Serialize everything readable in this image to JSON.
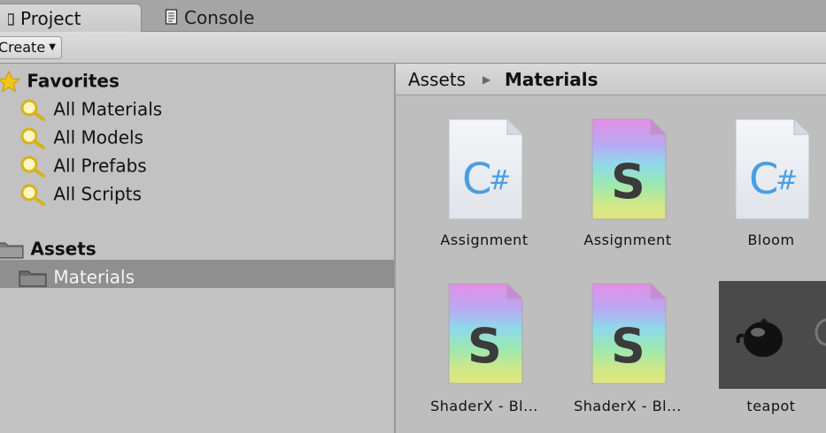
{
  "tabs": [
    {
      "label": "Project",
      "icon": "project-icon"
    },
    {
      "label": "Console",
      "icon": "console-icon"
    }
  ],
  "toolbar": {
    "create_label": "Create"
  },
  "sidebar": {
    "favorites_label": "Favorites",
    "favorites": [
      {
        "label": "All Materials"
      },
      {
        "label": "All Models"
      },
      {
        "label": "All Prefabs"
      },
      {
        "label": "All Scripts"
      }
    ],
    "assets_label": "Assets",
    "assets_children": [
      {
        "label": "Materials"
      }
    ]
  },
  "breadcrumb": {
    "root": "Assets",
    "current": "Materials"
  },
  "assets": [
    {
      "label": "Assignment",
      "type": "csharp-script-icon"
    },
    {
      "label": "Assignment",
      "type": "shader-icon"
    },
    {
      "label": "Bloom",
      "type": "csharp-script-icon"
    },
    {
      "label": "ShaderX - Bl...",
      "type": "shader-icon"
    },
    {
      "label": "ShaderX - Bl...",
      "type": "shader-icon"
    },
    {
      "label": "teapot",
      "type": "model-preview"
    }
  ],
  "colors": {
    "selection": "#8f8f8f",
    "background": "#c2c2c2",
    "folder": "#6f6f6f",
    "star": "#f2c414",
    "search": "#d8b21a"
  }
}
